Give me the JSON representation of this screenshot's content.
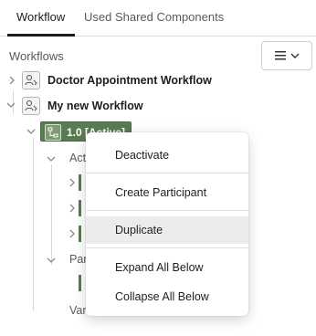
{
  "tabs": [
    {
      "label": "Workflow",
      "active": true
    },
    {
      "label": "Used Shared Components",
      "active": false
    }
  ],
  "section_label": "Workflows",
  "tree": {
    "nodes": [
      {
        "label": "Doctor Appointment Workflow",
        "expanded": false
      },
      {
        "label": "My new Workflow",
        "expanded": true
      },
      {
        "label": "1.0 [Active]",
        "expanded": true,
        "selected": true
      }
    ],
    "clipped_children": [
      "Act",
      "Par",
      "Var"
    ]
  },
  "context_menu": {
    "items": [
      "Deactivate",
      "Create Participant",
      "Duplicate",
      "Expand All Below",
      "Collapse All Below"
    ],
    "highlighted": "Duplicate"
  },
  "colors": {
    "selected_node": "#5a7a52",
    "menu_hover": "#ececec"
  },
  "icons": {
    "menu_button": "hamburger-icon",
    "workflow": "workflow-user-icon",
    "version": "version-diagram-icon"
  }
}
